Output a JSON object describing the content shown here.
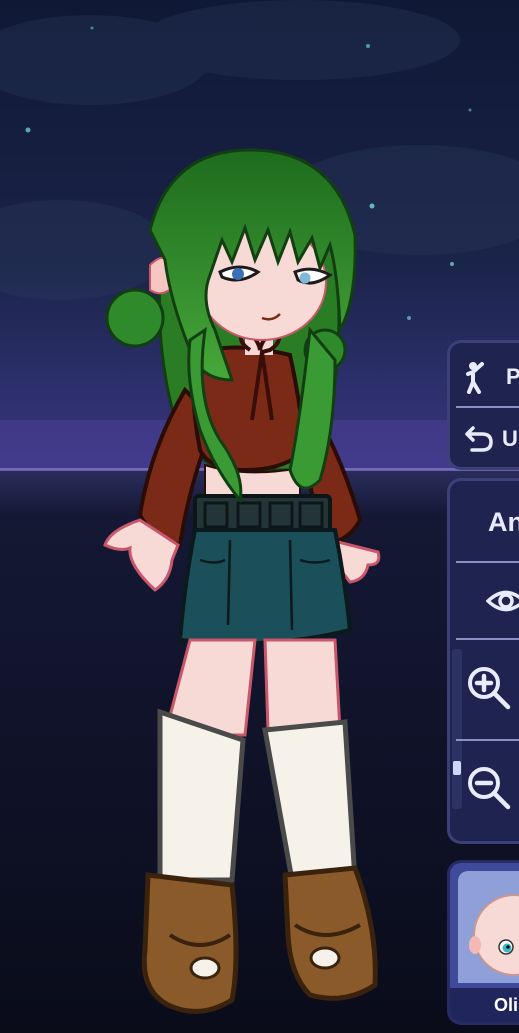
{
  "toolbar": {
    "pose_label": "P",
    "undo_label": "U",
    "animation_label": "An"
  },
  "icons": {
    "pose": "pose-figure-icon",
    "undo": "undo-arrow-icon",
    "visibility": "eye-icon",
    "zoom_in": "zoom-in-icon",
    "zoom_out": "zoom-out-icon",
    "character_avatar": "character-face-icon"
  },
  "character_card": {
    "name": "Oli"
  },
  "colors": {
    "panel_bg": "#1f2350",
    "panel_border": "#3b4178",
    "card_bg": "#3f4a9a",
    "icon_color": "#e8ecff",
    "hair": "#2f8a2b",
    "top": "#7a2a16",
    "skirt": "#1b4f5a",
    "boots": "#8a5a2a",
    "socks": "#f6f2ea"
  }
}
